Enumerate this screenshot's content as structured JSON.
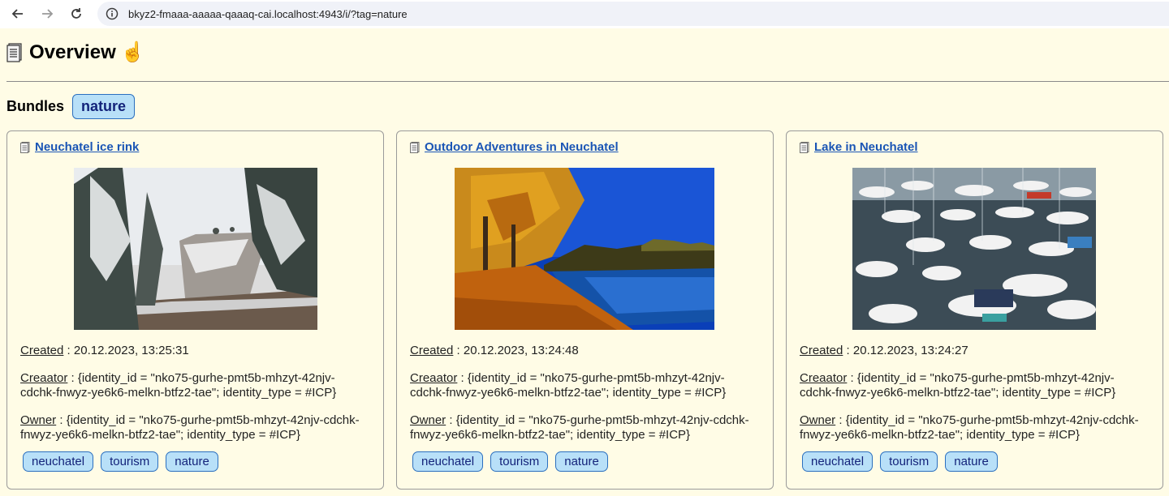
{
  "browser": {
    "url": "bkyz2-fmaaa-aaaaa-qaaaq-cai.localhost:4943/i/?tag=nature"
  },
  "page": {
    "title": "Overview",
    "bundles_label": "Bundles",
    "active_tag": "nature"
  },
  "labels": {
    "created": "Created",
    "creator": "Creaator",
    "owner": "Owner",
    "sep": " : "
  },
  "cards": [
    {
      "title": "Neuchatel ice rink",
      "image": "snowy-forest-cliff",
      "created": "20.12.2023, 13:25:31",
      "creator": "{identity_id = \"nko75-gurhe-pmt5b-mhzyt-42njv-cdchk-fnwyz-ye6k6-melkn-btfz2-tae\"; identity_type = #ICP}",
      "owner": "{identity_id = \"nko75-gurhe-pmt5b-mhzyt-42njv-cdchk-fnwyz-ye6k6-melkn-btfz2-tae\"; identity_type = #ICP}",
      "tags": [
        "neuchatel",
        "tourism",
        "nature"
      ]
    },
    {
      "title": "Outdoor Adventures in Neuchatel",
      "image": "autumn-lake",
      "created": "20.12.2023, 13:24:48",
      "creator": "{identity_id = \"nko75-gurhe-pmt5b-mhzyt-42njv-cdchk-fnwyz-ye6k6-melkn-btfz2-tae\"; identity_type = #ICP}",
      "owner": "{identity_id = \"nko75-gurhe-pmt5b-mhzyt-42njv-cdchk-fnwyz-ye6k6-melkn-btfz2-tae\"; identity_type = #ICP}",
      "tags": [
        "neuchatel",
        "tourism",
        "nature"
      ]
    },
    {
      "title": "Lake in Neuchatel",
      "image": "marina-boats",
      "created": "20.12.2023, 13:24:27",
      "creator": "{identity_id = \"nko75-gurhe-pmt5b-mhzyt-42njv-cdchk-fnwyz-ye6k6-melkn-btfz2-tae\"; identity_type = #ICP}",
      "owner": "{identity_id = \"nko75-gurhe-pmt5b-mhzyt-42njv-cdchk-fnwyz-ye6k6-melkn-btfz2-tae\"; identity_type = #ICP}",
      "tags": [
        "neuchatel",
        "tourism",
        "nature"
      ]
    }
  ],
  "colors": {
    "background": "#fffce6",
    "link": "#1a55b5",
    "tag_bg": "#b8e0f8",
    "tag_border": "#2b6fbf"
  },
  "icons": {
    "page": "document-icon",
    "hand": "pointing-hand-icon"
  }
}
